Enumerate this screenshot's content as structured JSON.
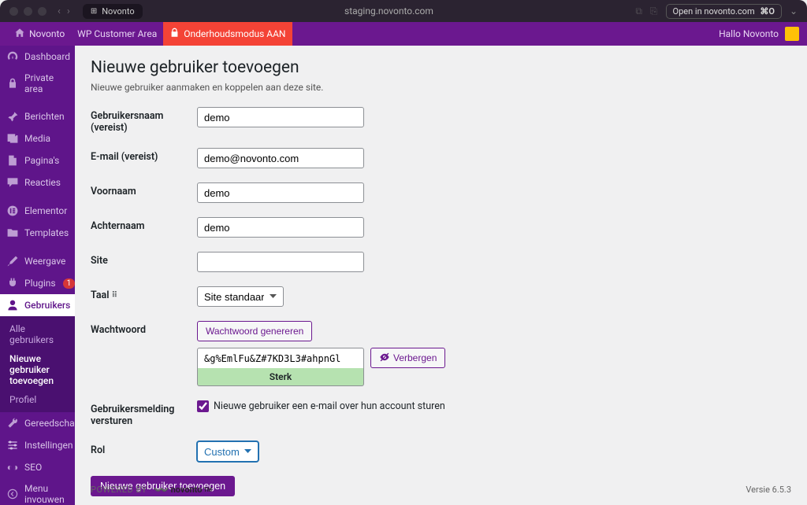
{
  "chrome": {
    "tab_label": "Novonto",
    "url_display": "staging.novonto.com",
    "open_in": "Open in novonto.com",
    "open_shortcut": "⌘O"
  },
  "adminbar": {
    "site": "Novonto",
    "customer_area": "WP Customer Area",
    "maintenance": "Onderhoudsmodus AAN",
    "greeting": "Hallo Novonto"
  },
  "sidebar": {
    "dashboard": "Dashboard",
    "private_area": "Private area",
    "posts": "Berichten",
    "media": "Media",
    "pages": "Pagina's",
    "comments": "Reacties",
    "elementor": "Elementor",
    "templates": "Templates",
    "appearance": "Weergave",
    "plugins": "Plugins",
    "plugins_count": "1",
    "users": "Gebruikers",
    "users_sub": {
      "all": "Alle gebruikers",
      "new": "Nieuwe gebruiker toevoegen",
      "profile": "Profiel"
    },
    "tools": "Gereedschap",
    "settings": "Instellingen",
    "seo": "SEO",
    "collapse": "Menu invouwen"
  },
  "page": {
    "title": "Nieuwe gebruiker toevoegen",
    "desc": "Nieuwe gebruiker aanmaken en koppelen aan deze site."
  },
  "form": {
    "username_label": "Gebruikersnaam (vereist)",
    "username_val": "demo",
    "email_label": "E-mail (vereist)",
    "email_val": "demo@novonto.com",
    "first_label": "Voornaam",
    "first_val": "demo",
    "last_label": "Achternaam",
    "last_val": "demo",
    "site_label": "Site",
    "site_val": "",
    "lang_label": "Taal",
    "lang_val": "Site standaard",
    "pw_label": "Wachtwoord",
    "pw_generate": "Wachtwoord genereren",
    "pw_val": "&g%EmlFu&Z#7KD3L3#ahpnGl",
    "pw_strength": "Sterk",
    "pw_hide": "Verbergen",
    "notify_label": "Gebruikersmelding versturen",
    "notify_check": "Nieuwe gebruiker een e-mail over hun account sturen",
    "role_label": "Rol",
    "role_val": "Customer",
    "submit": "Nieuwe gebruiker toevoegen"
  },
  "footer": {
    "powered": "POWERED BY",
    "brand": "novonto",
    "tm": "TM",
    "version": "Versie 6.5.3"
  }
}
